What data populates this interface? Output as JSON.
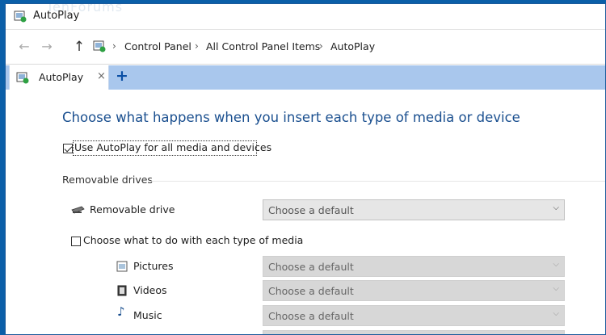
{
  "window": {
    "title": "AutoPlay",
    "watermark": "TenForums"
  },
  "nav": {
    "back_icon": "back-arrow-icon",
    "forward_icon": "forward-arrow-icon",
    "up_icon": "up-arrow-icon",
    "breadcrumbs": [
      "Control Panel",
      "All Control Panel Items",
      "AutoPlay"
    ]
  },
  "tab": {
    "label": "AutoPlay",
    "close": "×",
    "new_tab": "+"
  },
  "page": {
    "heading": "Choose what happens when you insert each type of media or device",
    "use_autoplay": {
      "label": "Use AutoPlay for all media and devices",
      "checked": true
    },
    "section_title": "Removable drives",
    "removable_drive": {
      "label": "Removable drive",
      "value": "Choose a default"
    },
    "per_media": {
      "label": "Choose what to do with each type of media",
      "checked": false
    },
    "media_rows": [
      {
        "label": "Pictures",
        "value": "Choose a default",
        "icon": "pictures-icon"
      },
      {
        "label": "Videos",
        "value": "Choose a default",
        "icon": "videos-icon"
      },
      {
        "label": "Music",
        "value": "Choose a default",
        "icon": "music-icon"
      }
    ]
  },
  "colors": {
    "heading": "#1a4f8f",
    "tabstrip": "#a9c7ed",
    "frame": "#0b5fa8"
  }
}
